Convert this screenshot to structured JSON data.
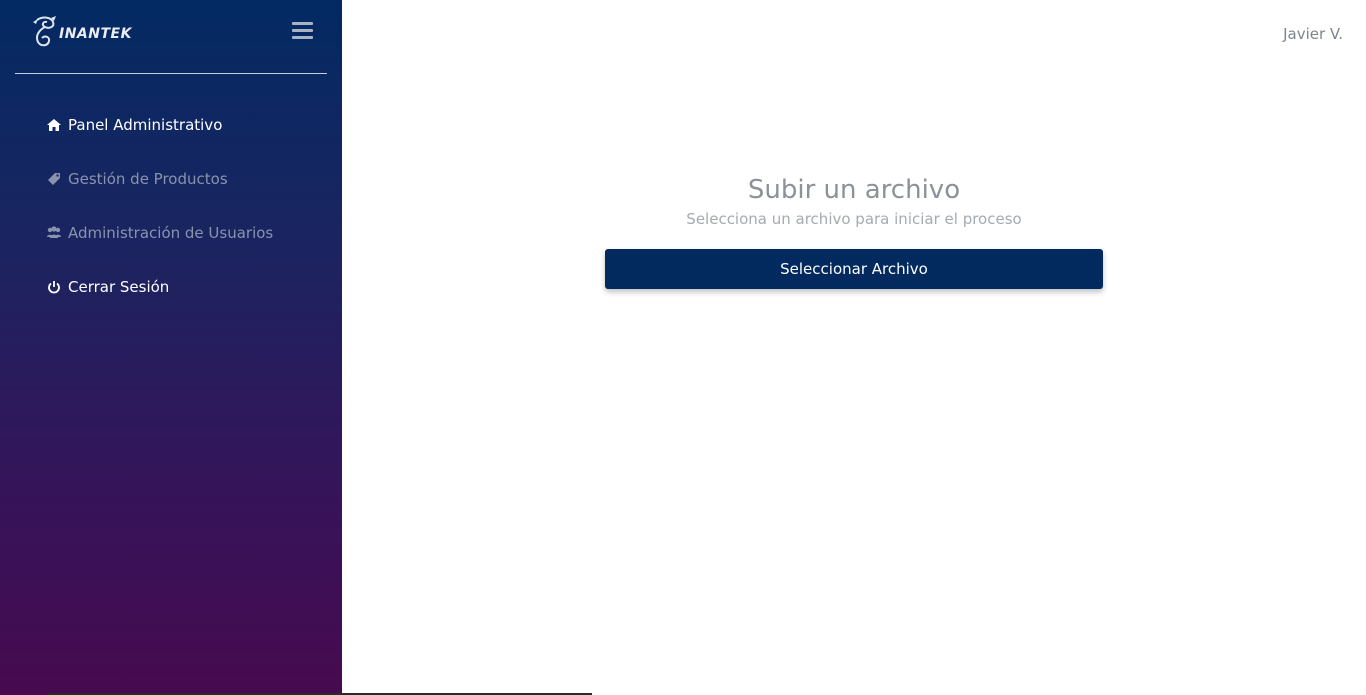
{
  "brand": {
    "logo_text": "INANTEK",
    "logo_icon": "dragon-logo-icon",
    "menu_icon": "hamburger-icon"
  },
  "sidebar": {
    "items": [
      {
        "label": "Panel Administrativo",
        "icon": "home-icon",
        "state": "active"
      },
      {
        "label": "Gestión de Productos",
        "icon": "tag-icon",
        "state": "muted"
      },
      {
        "label": "Administración de Usuarios",
        "icon": "users-icon",
        "state": "muted"
      },
      {
        "label": "Cerrar Sesión",
        "icon": "power-icon",
        "state": "normal"
      }
    ]
  },
  "header": {
    "user_name": "Javier V."
  },
  "upload": {
    "title": "Subir un archivo",
    "subtitle": "Selecciona un archivo para iniciar el proceso",
    "button_label": "Seleccionar Archivo"
  },
  "colors": {
    "sidebar_top": "#032a63",
    "sidebar_bottom": "#470a4f",
    "button_bg": "#022a5f",
    "muted_text": "#8a93ad"
  }
}
